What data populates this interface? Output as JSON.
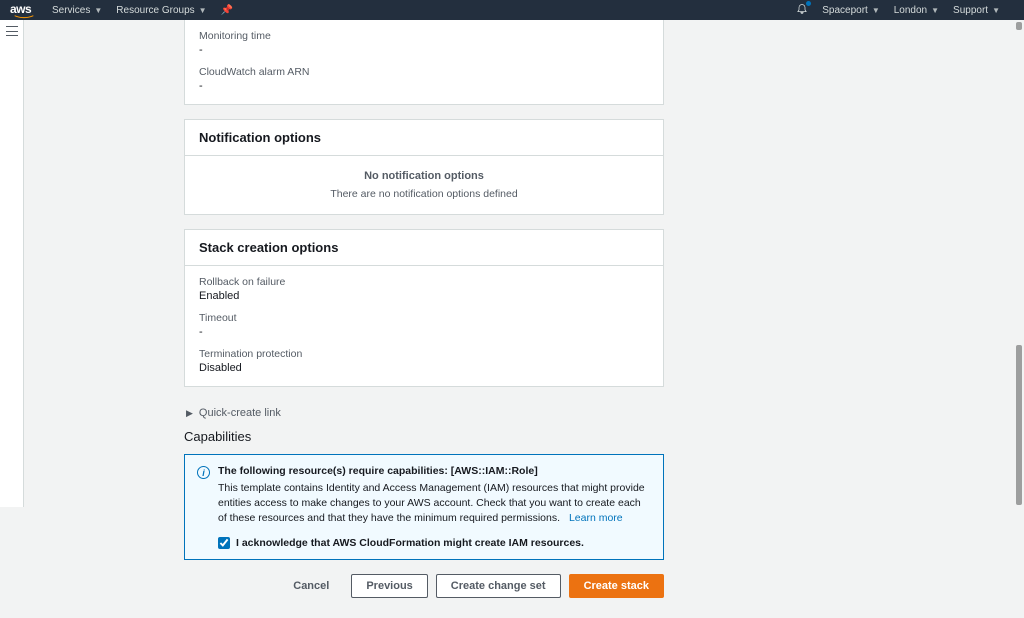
{
  "nav": {
    "logo": "aws",
    "services": "Services",
    "resourceGroups": "Resource Groups",
    "account": "Spaceport",
    "region": "London",
    "support": "Support"
  },
  "rollbackSection": {
    "monitoringTimeLabel": "Monitoring time",
    "monitoringTimeValue": "-",
    "alarmLabel": "CloudWatch alarm ARN",
    "alarmValue": "-"
  },
  "notificationCard": {
    "title": "Notification options",
    "emptyTitle": "No notification options",
    "emptySub": "There are no notification options defined"
  },
  "stackCreationCard": {
    "title": "Stack creation options",
    "rollbackLabel": "Rollback on failure",
    "rollbackValue": "Enabled",
    "timeoutLabel": "Timeout",
    "timeoutValue": "-",
    "terminationLabel": "Termination protection",
    "terminationValue": "Disabled"
  },
  "quickCreate": {
    "label": "Quick-create link"
  },
  "capabilities": {
    "heading": "Capabilities",
    "alertTitle": "The following resource(s) require capabilities: [AWS::IAM::Role]",
    "alertText": "This template contains Identity and Access Management (IAM) resources that might provide entities access to make changes to your AWS account. Check that you want to create each of these resources and that they have the minimum required permissions.",
    "learnMore": "Learn more",
    "ackLabel": "I acknowledge that AWS CloudFormation might create IAM resources."
  },
  "buttons": {
    "cancel": "Cancel",
    "previous": "Previous",
    "createChangeSet": "Create change set",
    "createStack": "Create stack"
  }
}
